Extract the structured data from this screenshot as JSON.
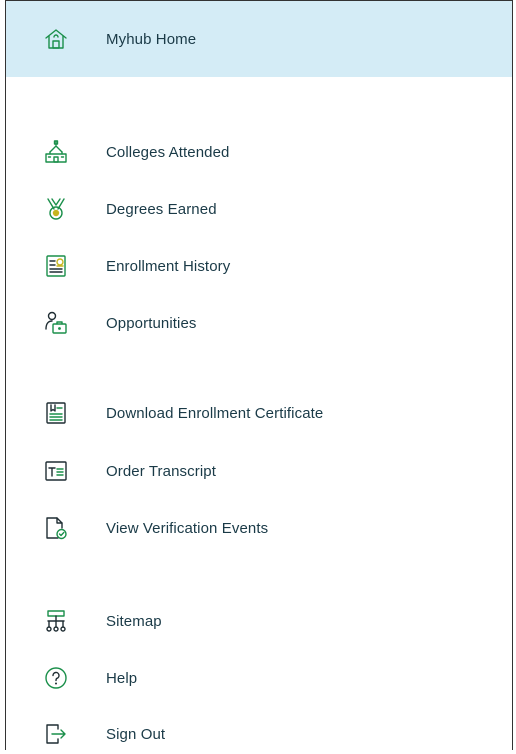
{
  "colors": {
    "accent_bg": "#d4ecf6",
    "text": "#1a3a47",
    "icon_green": "#1a8f4a",
    "icon_yellow": "#c6b51f",
    "icon_dark": "#1f2d33"
  },
  "menu": {
    "home": {
      "label": "Myhub Home",
      "icon": "house-icon"
    },
    "group1": [
      {
        "label": "Colleges Attended",
        "icon": "school-building-icon"
      },
      {
        "label": "Degrees Earned",
        "icon": "medal-icon"
      },
      {
        "label": "Enrollment History",
        "icon": "document-list-icon"
      },
      {
        "label": "Opportunities",
        "icon": "person-briefcase-icon"
      }
    ],
    "group2": [
      {
        "label": "Download Enrollment Certificate",
        "icon": "certificate-icon"
      },
      {
        "label": "Order Transcript",
        "icon": "transcript-icon"
      },
      {
        "label": "View Verification Events",
        "icon": "document-check-icon"
      }
    ],
    "group3": [
      {
        "label": "Sitemap",
        "icon": "sitemap-icon"
      },
      {
        "label": "Help",
        "icon": "question-circle-icon"
      },
      {
        "label": "Sign Out",
        "icon": "sign-out-icon"
      }
    ]
  }
}
